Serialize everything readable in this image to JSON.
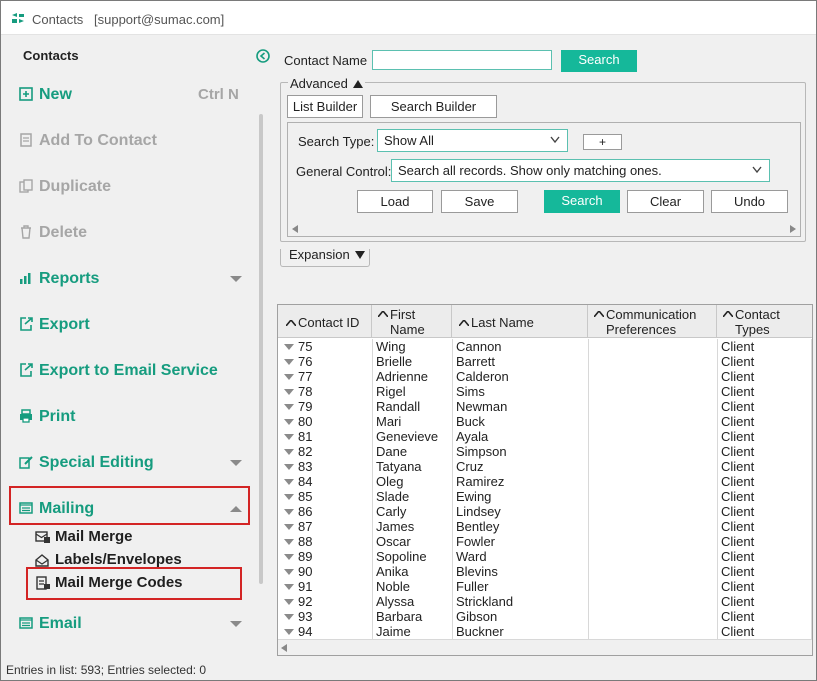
{
  "window": {
    "app_title": "Contacts",
    "user": "[support@sumac.com]"
  },
  "sidebar": {
    "heading": "Contacts",
    "items": [
      {
        "label": "New",
        "icon": "plus-square-icon",
        "shortcut": "Ctrl N",
        "enabled": true
      },
      {
        "label": "Add To Contact",
        "icon": "document-add-icon",
        "enabled": false
      },
      {
        "label": "Duplicate",
        "icon": "duplicate-icon",
        "enabled": false
      },
      {
        "label": "Delete",
        "icon": "trash-icon",
        "enabled": false
      },
      {
        "label": "Reports",
        "icon": "bar-chart-icon",
        "enabled": true,
        "expandable": true
      },
      {
        "label": "Export",
        "icon": "export-icon",
        "enabled": true
      },
      {
        "label": "Export to Email Service",
        "icon": "export-icon",
        "enabled": true
      },
      {
        "label": "Print",
        "icon": "printer-icon",
        "enabled": true
      },
      {
        "label": "Special Editing",
        "icon": "edit-icon",
        "enabled": true,
        "expandable": true
      },
      {
        "label": "Mailing",
        "icon": "mail-icon",
        "enabled": true,
        "expanded": true
      },
      {
        "label": "Email",
        "icon": "mail-icon",
        "enabled": true,
        "expandable": true
      }
    ],
    "mailing_subitems": [
      {
        "label": "Mail Merge",
        "icon": "mail-merge-icon"
      },
      {
        "label": "Labels/Envelopes",
        "icon": "labels-icon"
      },
      {
        "label": "Mail Merge Codes",
        "icon": "mail-merge-codes-icon"
      }
    ]
  },
  "search": {
    "contact_name_label": "Contact Name",
    "contact_name_value": "",
    "search_button": "Search",
    "advanced_label": "Advanced",
    "list_builder_button": "List Builder",
    "search_builder_button": "Search Builder",
    "search_type_label": "Search Type:",
    "search_type_value": "Show All",
    "add_button": "+",
    "general_control_label": "General Control:",
    "general_control_value": "Search all records. Show only matching ones.",
    "load_button": "Load",
    "save_button": "Save",
    "search2_button": "Search",
    "clear_button": "Clear",
    "undo_button": "Undo",
    "expansion_label": "Expansion"
  },
  "table": {
    "columns": [
      {
        "label": "Contact ID"
      },
      {
        "label_line1": "First",
        "label_line2": "Name"
      },
      {
        "label": "Last Name"
      },
      {
        "label_line1": "Communication",
        "label_line2": "Preferences"
      },
      {
        "label_line1": "Contact",
        "label_line2": "Types"
      }
    ],
    "rows": [
      {
        "id": "75",
        "first": "Wing",
        "last": "Cannon",
        "comm": "",
        "type": "Client"
      },
      {
        "id": "76",
        "first": "Brielle",
        "last": "Barrett",
        "comm": "",
        "type": "Client"
      },
      {
        "id": "77",
        "first": "Adrienne",
        "last": "Calderon",
        "comm": "",
        "type": "Client"
      },
      {
        "id": "78",
        "first": "Rigel",
        "last": "Sims",
        "comm": "",
        "type": "Client"
      },
      {
        "id": "79",
        "first": "Randall",
        "last": "Newman",
        "comm": "",
        "type": "Client"
      },
      {
        "id": "80",
        "first": "Mari",
        "last": "Buck",
        "comm": "",
        "type": "Client"
      },
      {
        "id": "81",
        "first": "Genevieve",
        "last": "Ayala",
        "comm": "",
        "type": "Client"
      },
      {
        "id": "82",
        "first": "Dane",
        "last": "Simpson",
        "comm": "",
        "type": "Client"
      },
      {
        "id": "83",
        "first": "Tatyana",
        "last": "Cruz",
        "comm": "",
        "type": "Client"
      },
      {
        "id": "84",
        "first": "Oleg",
        "last": "Ramirez",
        "comm": "",
        "type": "Client"
      },
      {
        "id": "85",
        "first": "Slade",
        "last": "Ewing",
        "comm": "",
        "type": "Client"
      },
      {
        "id": "86",
        "first": "Carly",
        "last": "Lindsey",
        "comm": "",
        "type": "Client"
      },
      {
        "id": "87",
        "first": "James",
        "last": "Bentley",
        "comm": "",
        "type": "Client"
      },
      {
        "id": "88",
        "first": "Oscar",
        "last": "Fowler",
        "comm": "",
        "type": "Client"
      },
      {
        "id": "89",
        "first": "Sopoline",
        "last": "Ward",
        "comm": "",
        "type": "Client"
      },
      {
        "id": "90",
        "first": "Anika",
        "last": "Blevins",
        "comm": "",
        "type": "Client"
      },
      {
        "id": "91",
        "first": "Noble",
        "last": "Fuller",
        "comm": "",
        "type": "Client"
      },
      {
        "id": "92",
        "first": "Alyssa",
        "last": "Strickland",
        "comm": "",
        "type": "Client"
      },
      {
        "id": "93",
        "first": "Barbara",
        "last": "Gibson",
        "comm": "",
        "type": "Client"
      },
      {
        "id": "94",
        "first": "Jaime",
        "last": "Buckner",
        "comm": "",
        "type": "Client"
      }
    ]
  },
  "status": {
    "text": "Entries in list: 593; Entries selected: 0"
  },
  "colors": {
    "accent": "#15b89a",
    "sidebar_text": "#169c7f",
    "highlight_border": "#d32424",
    "disabled": "#a6a6a6"
  }
}
